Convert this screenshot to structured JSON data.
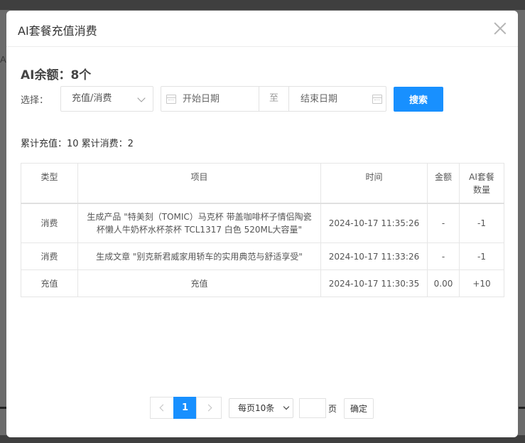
{
  "background": {
    "letter": "A",
    "close": "×"
  },
  "modal": {
    "title": "AI套餐充值消费",
    "balance": "AI余额：8个"
  },
  "filter": {
    "label": "选择：",
    "type_value": "充值/消费",
    "start_placeholder": "开始日期",
    "separator": "至",
    "end_placeholder": "结束日期",
    "search_label": "搜索"
  },
  "summary": "累计充值：10 累计消费：2",
  "table": {
    "headers": [
      "类型",
      "项目",
      "时间",
      "金额",
      "AI套餐数量"
    ],
    "rows": [
      {
        "type": "消费",
        "item": "生成产品 \"特美刻（TOMIC）马克杯 带盖咖啡杯子情侣陶瓷杯懒人牛奶杯水杯茶杯 TCL1317 白色 520ML大容量\"",
        "time": "2024-10-17 11:35:26",
        "amount": "-",
        "qty": "-1"
      },
      {
        "type": "消费",
        "item": "生成文章 \"别克新君威家用轿车的实用典范与舒适享受\"",
        "time": "2024-10-17 11:33:26",
        "amount": "-",
        "qty": "-1"
      },
      {
        "type": "充值",
        "item": "充值",
        "time": "2024-10-17 11:30:35",
        "amount": "0.00",
        "qty": "+10"
      }
    ]
  },
  "pagination": {
    "current_page": "1",
    "page_size": "每页10条",
    "page_unit": "页",
    "confirm_label": "确定"
  },
  "colors": {
    "primary": "#1890ff",
    "border": "#e6e6e6",
    "overlay": "#5f5f5f"
  }
}
